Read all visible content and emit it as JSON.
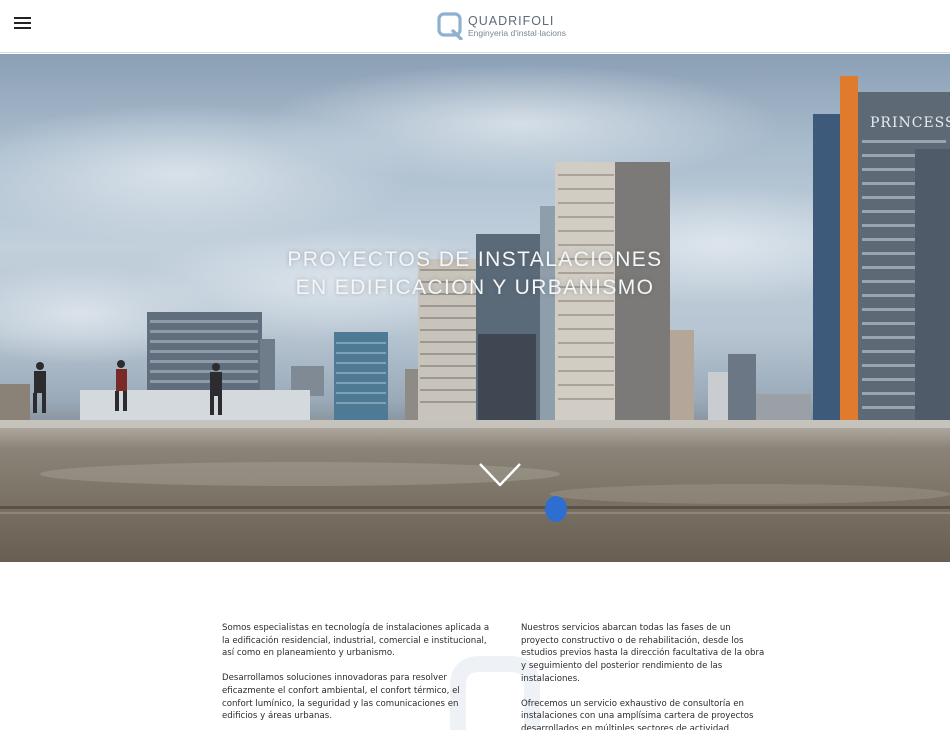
{
  "header": {
    "menu_icon": "hamburger-icon",
    "logo_name": "QUADRIFOLI",
    "logo_tagline": "Enginyeria d'instal·lacions",
    "logo_color": "#8fb1cf"
  },
  "hero": {
    "title_line1": "PROYECTOS DE INSTALACIONES",
    "title_line2": "EN EDIFICACION Y URBANISMO",
    "building_sign": "PRINCESS",
    "scroll_icon": "chevron-down-icon"
  },
  "content": {
    "left": {
      "p1": "Somos especialistas en tecnología de instalaciones aplicada a la edificación residencial, industrial, comercial e institucional, así como en planeamiento y urbanismo.",
      "p2": "Desarrollamos soluciones innovadoras para resolver eficazmente el confort ambiental, el confort térmico, el confort lumínico, la seguridad y las comunicaciones en edificios y áreas urbanas."
    },
    "right": {
      "p1": "Nuestros servicios abarcan todas las fases de un proyecto constructivo o de rehabilitación, desde los estudios previos hasta la dirección facultativa de la obra y  seguimiento del posterior rendimiento de las instalaciones.",
      "p2": "Ofrecemos un servicio exhaustivo de consultoría en instalaciones con una amplísima cartera de proyectos desarrollados en múltiples sectores de actividad."
    }
  }
}
